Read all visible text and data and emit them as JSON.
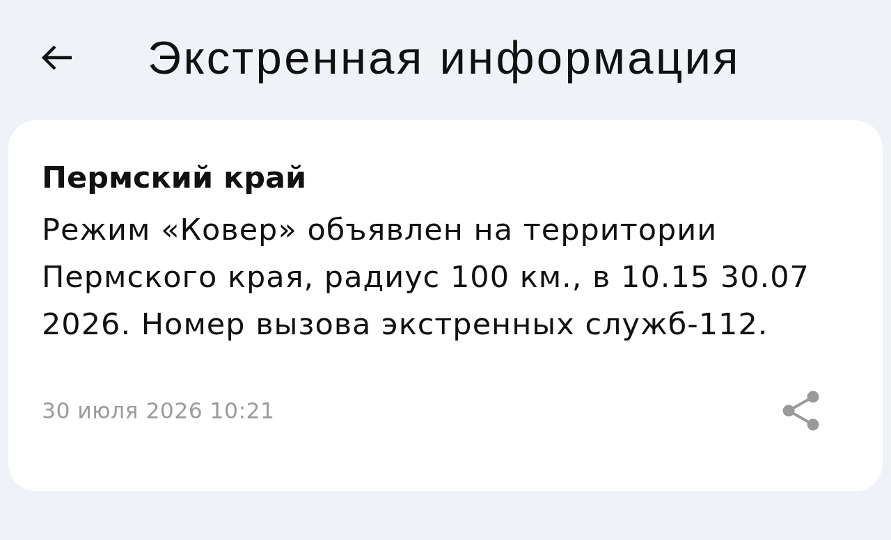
{
  "header": {
    "title": "Экстренная информация"
  },
  "alert": {
    "region": "Пермский край",
    "message": "Режим «Ковер» объявлен на территории Пермского края, радиус 100 км., в 10.15 30.07 2026. Номер вызова экстренных служб-112.",
    "timestamp": "30 июля 2026 10:21"
  }
}
